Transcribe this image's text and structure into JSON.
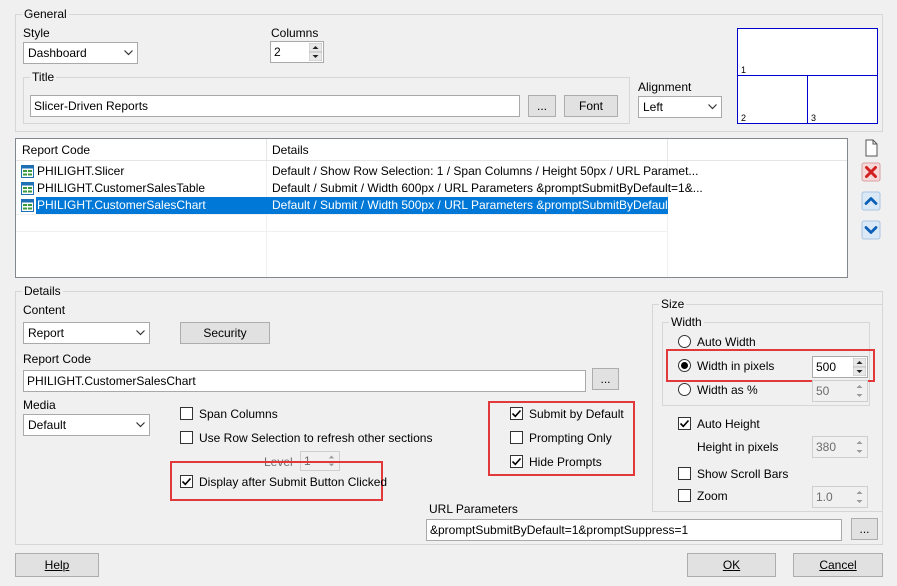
{
  "general": {
    "caption": "General",
    "style_label": "Style",
    "style_value": "Dashboard",
    "columns_label": "Columns",
    "columns_value": "2",
    "title_label": "Title",
    "title_value": "Slicer-Driven Reports",
    "ellipsis_label": "...",
    "font_label": "Font",
    "alignment_label": "Alignment",
    "alignment_value": "Left",
    "preview_cells": [
      "1",
      "2",
      "3"
    ]
  },
  "report_list": {
    "headers": [
      "Report Code",
      "Details"
    ],
    "rows": [
      {
        "code": "PHILIGHT.Slicer",
        "details": "Default / Show Row Selection: 1 / Span Columns / Height 50px / URL Paramet..."
      },
      {
        "code": "PHILIGHT.CustomerSalesTable",
        "details": "Default / Submit / Width 600px / URL Parameters &promptSubmitByDefault=1&..."
      },
      {
        "code": "PHILIGHT.CustomerSalesChart",
        "details": "Default / Submit / Width 500px / URL Parameters &promptSubmitByDefault=1&...",
        "selected": true
      }
    ],
    "side_icons": [
      "new-document-icon",
      "delete-x-icon",
      "move-up-icon",
      "move-down-icon"
    ]
  },
  "details": {
    "caption": "Details",
    "content_label": "Content",
    "content_value": "Report",
    "security_label": "Security",
    "report_code_label": "Report Code",
    "report_code_value": "PHILIGHT.CustomerSalesChart",
    "ellipsis_label": "...",
    "media_label": "Media",
    "media_value": "Default",
    "span_columns_label": "Span Columns",
    "span_columns_checked": false,
    "row_selection_label": "Use Row Selection to refresh other sections",
    "row_selection_checked": false,
    "level_label": "Level",
    "level_value": "1",
    "display_after_submit_label": "Display after Submit Button Clicked",
    "display_after_submit_checked": true,
    "submit_by_default_label": "Submit by Default",
    "submit_by_default_checked": true,
    "prompting_only_label": "Prompting Only",
    "prompting_only_checked": false,
    "hide_prompts_label": "Hide Prompts",
    "hide_prompts_checked": true,
    "url_parameters_label": "URL Parameters",
    "url_parameters_value": "&promptSubmitByDefault=1&promptSuppress=1",
    "url_ellipsis_label": "..."
  },
  "size": {
    "caption": "Size",
    "width_caption": "Width",
    "auto_width_label": "Auto Width",
    "width_in_pixels_label": "Width in pixels",
    "width_in_pixels_value": "500",
    "width_as_percent_label": "Width as %",
    "width_as_percent_value": "50",
    "auto_height_label": "Auto Height",
    "auto_height_checked": true,
    "height_in_pixels_label": "Height in pixels",
    "height_in_pixels_value": "380",
    "show_scroll_bars_label": "Show Scroll Bars",
    "show_scroll_bars_checked": false,
    "zoom_label": "Zoom",
    "zoom_checked": false,
    "zoom_value": "1.0"
  },
  "footer": {
    "help_label": "Help",
    "ok_label": "OK",
    "cancel_label": "Cancel"
  },
  "colors": {
    "selection": "#0078d7",
    "highlight_box": "#e0383b",
    "preview_border": "#0000cc"
  }
}
